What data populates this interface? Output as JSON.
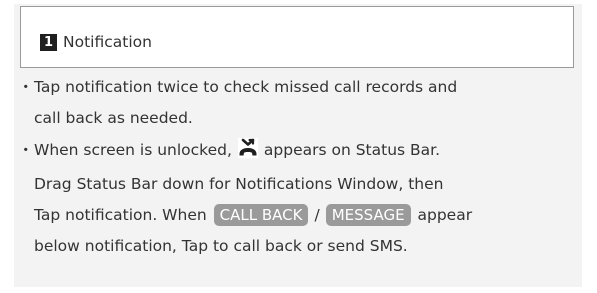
{
  "header": {
    "step_number": "1",
    "title": "Notification"
  },
  "bullet_symbol": "・",
  "bullets": [
    {
      "lines": [
        "Tap notification twice to check missed call records and",
        "call back as needed."
      ]
    },
    {
      "line1_before_icon": "When screen is unlocked,",
      "icon": "missed-call-icon",
      "line1_after_icon": "appears on Status Bar.",
      "line2": "Drag Status Bar down for Notifications Window, then",
      "line3_before": "Tap notification. When",
      "button_call_back": "CALL BACK",
      "separator": "/",
      "button_message": "MESSAGE",
      "line3_after": "appear",
      "line4": "below notification, Tap to call back or send SMS."
    }
  ],
  "colors": {
    "panel_bg": "#f3f3f3",
    "header_border": "#9a9a9a",
    "pill_bg": "#9a9a9a",
    "badge_bg": "#1f1f1f",
    "text": "#333333"
  }
}
